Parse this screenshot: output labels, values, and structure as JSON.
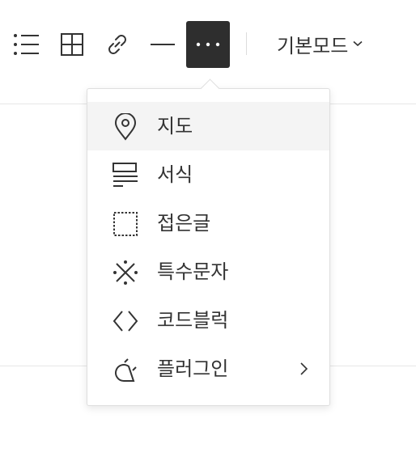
{
  "toolbar": {
    "buttons": [
      {
        "icon": "bulleted-list-icon"
      },
      {
        "icon": "table-icon"
      },
      {
        "icon": "link-icon"
      },
      {
        "icon": "horizontal-line-icon"
      },
      {
        "icon": "more-icon",
        "active": true
      }
    ],
    "mode_label": "기본모드",
    "mode_icon": "chevron-down-icon"
  },
  "menu": {
    "items": [
      {
        "label": "지도",
        "icon": "map-pin-icon",
        "highlighted": true
      },
      {
        "label": "서식",
        "icon": "template-icon"
      },
      {
        "label": "접은글",
        "icon": "fold-box-icon"
      },
      {
        "label": "특수문자",
        "icon": "special-char-icon"
      },
      {
        "label": "코드블럭",
        "icon": "code-icon"
      },
      {
        "label": "플러그인",
        "icon": "plugin-icon",
        "submenu_icon": "chevron-right-icon"
      }
    ]
  },
  "colors": {
    "active_button_bg": "#2e2e2e",
    "hover_bg": "#f4f4f4",
    "border": "#dedede"
  }
}
